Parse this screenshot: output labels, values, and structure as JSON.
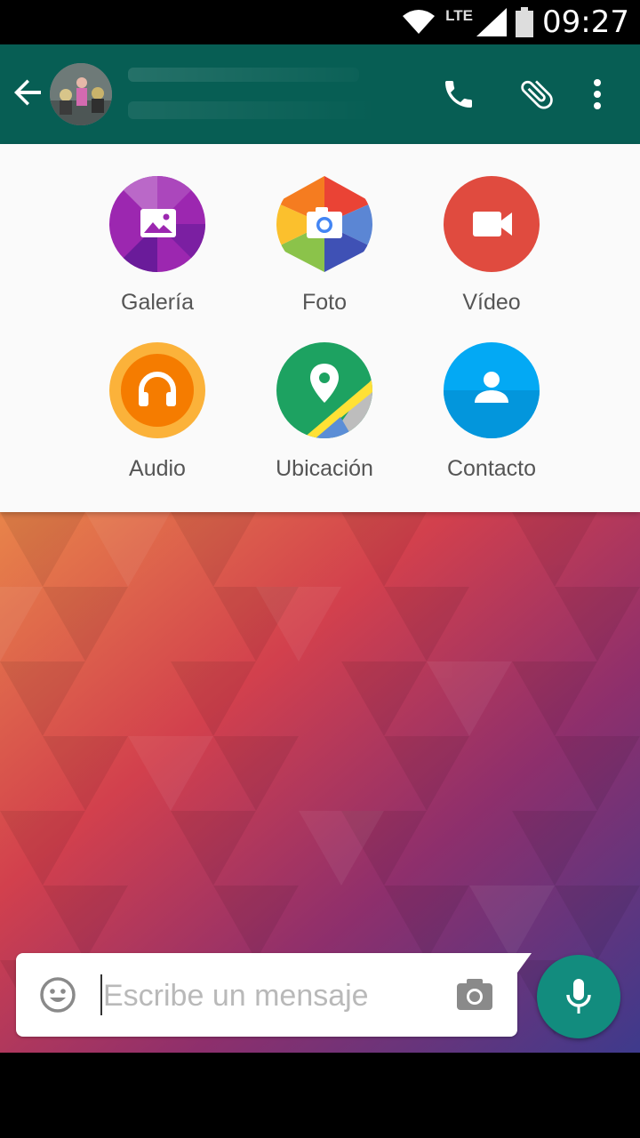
{
  "status_bar": {
    "network_label": "LTE",
    "time": "09:27",
    "icons": [
      "wifi-icon",
      "signal-icon",
      "battery-icon"
    ]
  },
  "app_bar": {
    "icons": [
      "back-arrow-icon",
      "phone-icon",
      "paperclip-icon",
      "more-vert-icon"
    ],
    "color": "#075e54"
  },
  "attach_menu": {
    "items": [
      {
        "label": "Galería",
        "icon": "gallery-icon",
        "color": "#9c27b0"
      },
      {
        "label": "Foto",
        "icon": "camera-icon",
        "color": "#4285f4"
      },
      {
        "label": "Vídeo",
        "icon": "video-icon",
        "color": "#e04b3f"
      },
      {
        "label": "Audio",
        "icon": "headphones-icon",
        "color": "#f57c00"
      },
      {
        "label": "Ubicación",
        "icon": "location-pin-icon",
        "color": "#1da261"
      },
      {
        "label": "Contacto",
        "icon": "contact-icon",
        "color": "#03a9f4"
      }
    ]
  },
  "composer": {
    "placeholder": "Escribe un mensaje",
    "value": "",
    "icons": [
      "emoji-icon",
      "camera-icon",
      "mic-icon"
    ],
    "accent": "#128c7e"
  }
}
